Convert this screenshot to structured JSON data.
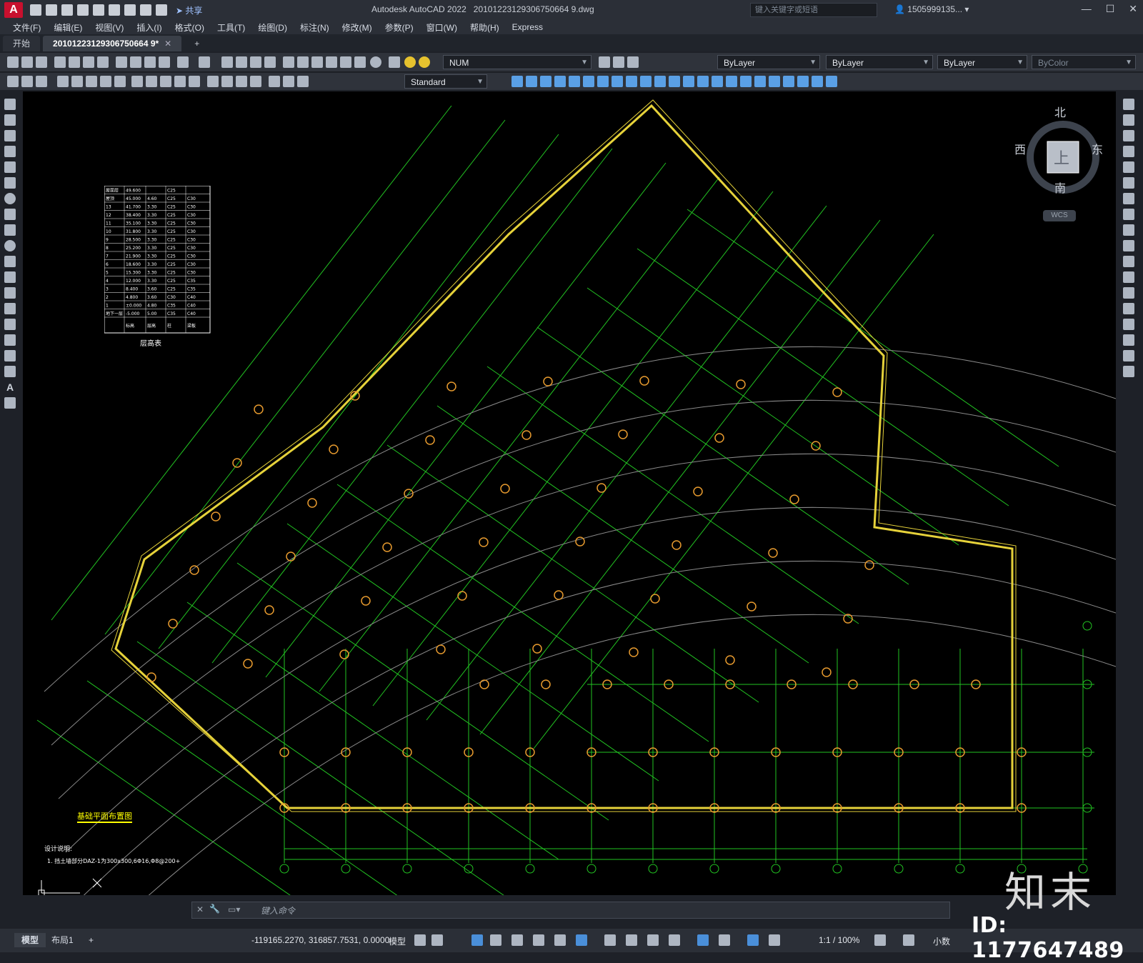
{
  "app": {
    "title": "Autodesk AutoCAD 2022",
    "file": "20101223129306750664 9.dwg",
    "share_label": "共享",
    "search_placeholder": "键入关键字或短语",
    "user": "1505999135...",
    "logo_letter": "A"
  },
  "menu": [
    "文件(F)",
    "编辑(E)",
    "视图(V)",
    "插入(I)",
    "格式(O)",
    "工具(T)",
    "绘图(D)",
    "标注(N)",
    "修改(M)",
    "参数(P)",
    "窗口(W)",
    "帮助(H)",
    "Express"
  ],
  "tabs": [
    {
      "label": "开始"
    },
    {
      "label": "20101223129306750664 9*"
    }
  ],
  "toolbar": {
    "layer": "NUM",
    "color": "ByLayer",
    "linetype": "ByLayer",
    "lineweight": "ByLayer",
    "plotstyle": "ByColor",
    "textstyle": "Standard"
  },
  "viewcube": {
    "north": "北",
    "south": "南",
    "east": "东",
    "west": "西",
    "top": "上",
    "wcs": "WCS"
  },
  "drawing": {
    "title": "基础平面布置图",
    "note_label": "设计说明:",
    "note_text": "1. 挡土墙部分DAZ-1为300x300,6Φ16,Φ8@200+",
    "table_caption": "层高表",
    "table_headers": [
      "标高",
      "层高",
      "柱",
      "梁板"
    ],
    "table_rows": [
      [
        "屋面层",
        "49.600",
        "",
        "C25",
        ""
      ],
      [
        "屋顶",
        "45.000",
        "4.60",
        "C25",
        "C30"
      ],
      [
        "13",
        "41.700",
        "3.30",
        "C25",
        "C30"
      ],
      [
        "12",
        "38.400",
        "3.30",
        "C25",
        "C30"
      ],
      [
        "11",
        "35.100",
        "3.30",
        "C25",
        "C30"
      ],
      [
        "10",
        "31.800",
        "3.30",
        "C25",
        "C30"
      ],
      [
        "9",
        "28.500",
        "3.30",
        "C25",
        "C30"
      ],
      [
        "8",
        "25.200",
        "3.30",
        "C25",
        "C30"
      ],
      [
        "7",
        "21.900",
        "3.30",
        "C25",
        "C30"
      ],
      [
        "6",
        "18.600",
        "3.30",
        "C25",
        "C30"
      ],
      [
        "5",
        "15.300",
        "3.30",
        "C25",
        "C30"
      ],
      [
        "4",
        "12.000",
        "3.30",
        "C25",
        "C35"
      ],
      [
        "3",
        "8.400",
        "3.60",
        "C25",
        "C35"
      ],
      [
        "2",
        "4.800",
        "3.60",
        "C30",
        "C40"
      ],
      [
        "1",
        "±0.000",
        "4.80",
        "C35",
        "C40"
      ],
      [
        "地下一层",
        "-5.000",
        "5.00",
        "C35",
        "C40"
      ]
    ]
  },
  "command": {
    "placeholder": "键入命令"
  },
  "status": {
    "model_tab": "模型",
    "layout_tab": "布局1",
    "coords": "-119165.2270, 316857.7531, 0.0000",
    "mode": "模型",
    "scale": "1:1 / 100%",
    "units": "小数"
  },
  "watermark": {
    "logo": "知末",
    "id": "ID: 1177647489"
  }
}
